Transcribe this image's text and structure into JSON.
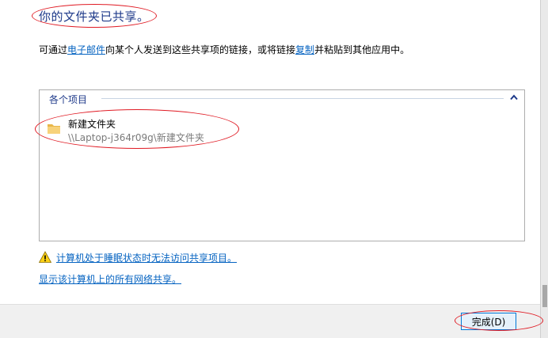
{
  "dialog": {
    "title": "你的文件夹已共享。",
    "desc": {
      "prefix": "可通过",
      "email_link": "电子邮件",
      "middle": "向某个人发送到这些共享项的链接，或将链接",
      "copy_link": "复制",
      "suffix": "并粘贴到其他应用中。"
    },
    "items": {
      "header_label": "各个项目",
      "folder": {
        "name": "新建文件夹",
        "path": "\\\\Laptop-j364r09g\\新建文件夹",
        "icon": "folder-icon"
      }
    },
    "warning_link": "计算机处于睡眠状态时无法访问共享项目。",
    "show_shares_link": "显示该计算机上的所有网络共享。",
    "done_button": "完成(D)"
  },
  "colors": {
    "title": "#1e3a8a",
    "link": "#0563c1",
    "annotation": "#e01b24",
    "footer": "#f0f0f0",
    "button_border": "#0078d7",
    "button_bg": "#e5f1fb"
  }
}
